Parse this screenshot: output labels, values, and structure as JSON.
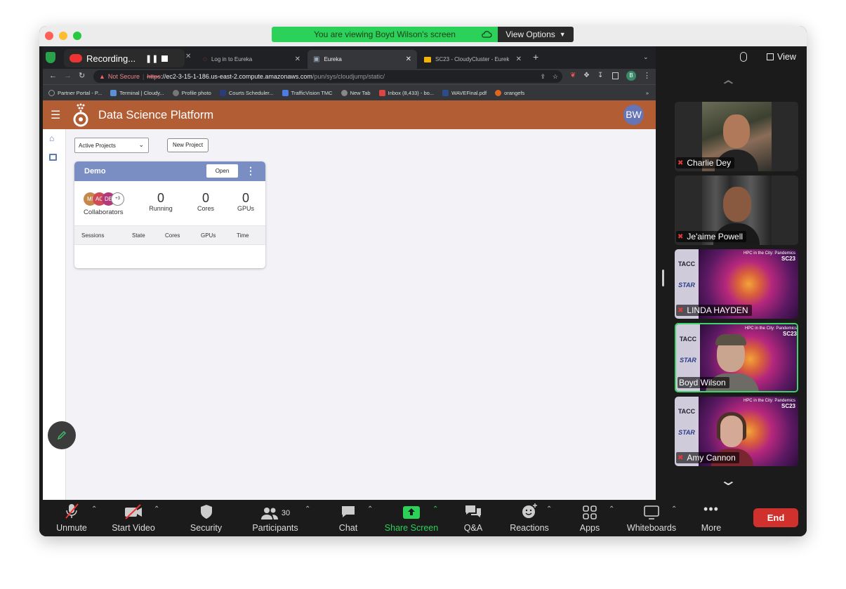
{
  "zoom_banner": {
    "viewing_text": "You are viewing Boyd Wilson's screen",
    "view_options": "View Options"
  },
  "browser": {
    "recording_label": "Recording...",
    "tabs": [
      {
        "title": "Log in to Eureka"
      },
      {
        "title": "Eureka"
      },
      {
        "title": "SC23 - CloudyCluster - Eureka"
      }
    ],
    "not_secure": "Not Secure",
    "url_scheme": "https",
    "url_host": "://ec2-3-15-1-186.us-east-2.compute.amazonaws.com",
    "url_path": "/pun/sys/cloudjump/static/",
    "profile_initial": "B",
    "bookmarks": [
      "Partner Portal - P...",
      "Terminal | Cloudy...",
      "Profile photo",
      "Courts Scheduler...",
      "TrafficVision TMC",
      "New Tab",
      "Inbox (8,433) - bo...",
      "WAVEFinal.pdf",
      "orangefs"
    ]
  },
  "app": {
    "title": "Data Science Platform",
    "user_initials": "BW",
    "project_filter": "Active Projects",
    "new_project_label": "New Project",
    "project": {
      "name": "Demo",
      "open_label": "Open",
      "avatars": [
        "MI",
        "AC",
        "DE",
        "+3"
      ],
      "collaborators_label": "Collaborators",
      "stats": [
        {
          "value": "0",
          "label": "Running"
        },
        {
          "value": "0",
          "label": "Cores"
        },
        {
          "value": "0",
          "label": "GPUs"
        }
      ],
      "session_headers": [
        "Sessions",
        "State",
        "Cores",
        "GPUs",
        "Time"
      ]
    }
  },
  "gallery": {
    "view_label": "View",
    "participants": [
      {
        "name": "Charlie Dey",
        "active": false
      },
      {
        "name": "Je'aime Powell",
        "active": false
      },
      {
        "name": "LINDA HAYDEN",
        "active": false
      },
      {
        "name": "Boyd Wilson",
        "active": true
      },
      {
        "name": "Amy Cannon",
        "active": false
      }
    ],
    "bg_logo_text": "TACC",
    "bg_star_text": "STAR",
    "bg_caption": "HPC in the City: Pandemics",
    "bg_sc": "SC23"
  },
  "toolbar": {
    "unmute": "Unmute",
    "start_video": "Start Video",
    "security": "Security",
    "participants_count": "30",
    "participants": "Participants",
    "chat": "Chat",
    "share_screen": "Share Screen",
    "qa": "Q&A",
    "reactions": "Reactions",
    "apps": "Apps",
    "whiteboards": "Whiteboards",
    "more": "More",
    "end": "End"
  },
  "colors": {
    "accent_header": "#b25d34",
    "project_header": "#7b8ec4",
    "share_green": "#2bd159",
    "end_red": "#d0312d"
  }
}
